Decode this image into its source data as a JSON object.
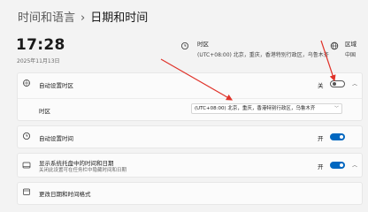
{
  "breadcrumb": {
    "parent": "时间和语言",
    "separator": "›",
    "current": "日期和时间"
  },
  "clock": {
    "time": "17:28",
    "date": "2025年11月13日"
  },
  "tz_info": {
    "title": "时区",
    "value": "(UTC+08:00) 北京，重庆，香港特别行政区，乌鲁木齐"
  },
  "region_info": {
    "title": "区域",
    "value": "中国"
  },
  "auto_timezone": {
    "label": "自动设置时区",
    "state": "关"
  },
  "timezone_row": {
    "label": "时区",
    "selected": "(UTC+08:00) 北京，重庆，香港特别行政区，乌鲁木齐"
  },
  "auto_time": {
    "label": "自动设置时间",
    "state": "开"
  },
  "tray": {
    "label": "显示系统托盘中的时间和日期",
    "sub": "关闭此设置可在任务栏中隐藏时间和日期",
    "state": "开"
  },
  "more": {
    "label": "更改日期和时间格式"
  },
  "colors": {
    "accent": "#0067c0",
    "arrow": "#e0332a"
  }
}
